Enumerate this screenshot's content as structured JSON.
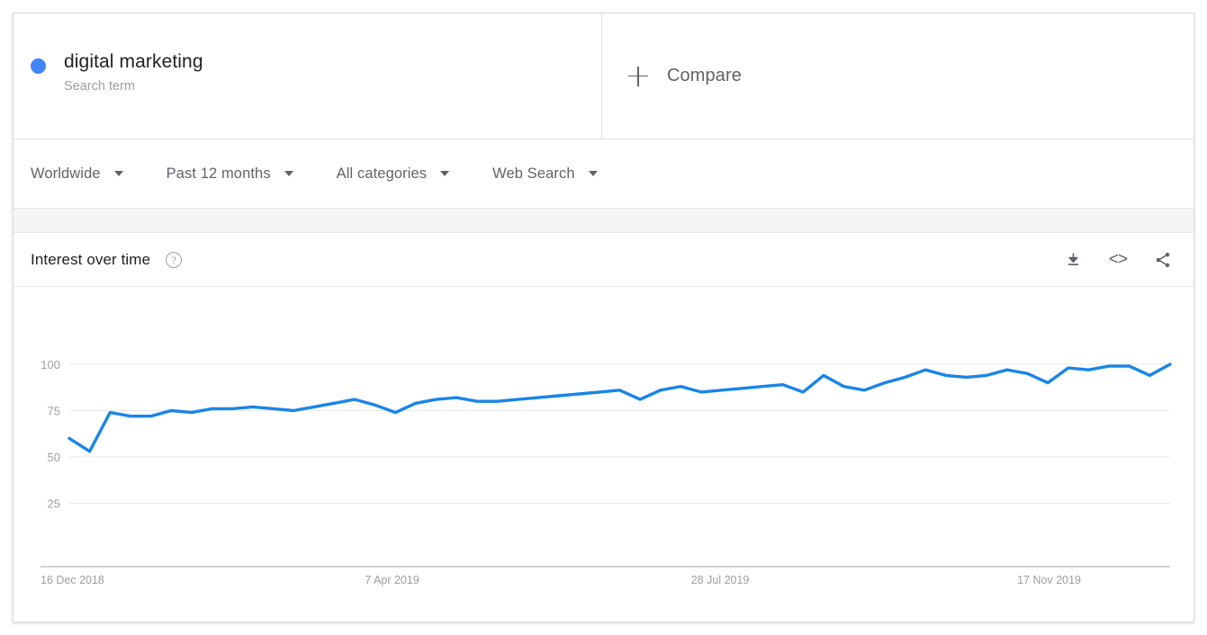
{
  "search_term": {
    "label": "digital marketing",
    "type_label": "Search term",
    "dot_color": "#4285f4"
  },
  "compare": {
    "label": "Compare",
    "icon": "plus-icon"
  },
  "filters": [
    {
      "label": "Worldwide",
      "icon": "chevron-down-icon"
    },
    {
      "label": "Past 12 months",
      "icon": "chevron-down-icon"
    },
    {
      "label": "All categories",
      "icon": "chevron-down-icon"
    },
    {
      "label": "Web Search",
      "icon": "chevron-down-icon"
    }
  ],
  "panel": {
    "title": "Interest over time",
    "help_icon": "help-circle-icon",
    "help_glyph": "?",
    "actions": [
      {
        "name": "download-icon",
        "label": "Download"
      },
      {
        "name": "embed-code-icon",
        "label": "<>"
      },
      {
        "name": "share-icon",
        "label": "Share"
      }
    ]
  },
  "chart_data": {
    "type": "line",
    "title": "Interest over time",
    "xlabel": "",
    "ylabel": "",
    "ylim": [
      0,
      105
    ],
    "yticks": [
      25,
      50,
      75,
      100
    ],
    "grid": true,
    "legend_position": "none",
    "line_color": "#1a85e8",
    "xtick_labels": [
      "16 Dec 2018",
      "7 Apr 2019",
      "28 Jul 2019",
      "17 Nov 2019"
    ],
    "xtick_indices": [
      0,
      16,
      32,
      48
    ],
    "series": [
      {
        "name": "digital marketing",
        "color": "#1a85e8",
        "values": [
          60,
          53,
          74,
          72,
          72,
          75,
          74,
          76,
          76,
          77,
          76,
          75,
          77,
          79,
          81,
          78,
          74,
          79,
          81,
          82,
          80,
          80,
          81,
          82,
          83,
          84,
          85,
          86,
          81,
          86,
          88,
          85,
          86,
          87,
          88,
          89,
          85,
          94,
          88,
          86,
          90,
          93,
          97,
          94,
          93,
          94,
          97,
          95,
          90,
          98,
          97,
          99,
          99,
          94,
          100
        ]
      }
    ]
  }
}
